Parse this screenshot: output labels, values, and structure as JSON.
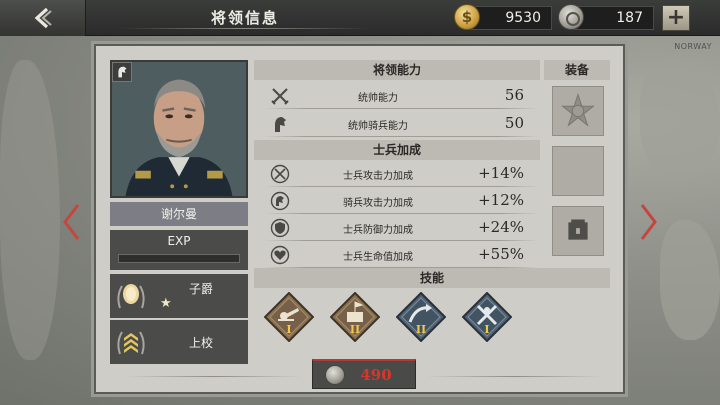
{
  "header": {
    "title": "将领信息",
    "coins": "9530",
    "medals": "187",
    "back_icon": "chevron-left-icon",
    "add_icon": "plus-icon"
  },
  "map": {
    "label": "NORWAY"
  },
  "general": {
    "name": "谢尔曼",
    "exp_label": "EXP",
    "exp_progress": 0,
    "titles": [
      {
        "name": "子爵",
        "stars": "★"
      },
      {
        "name": "上校"
      }
    ]
  },
  "abilities": {
    "heading": "将领能力",
    "rows": [
      {
        "icon": "crossed-swords-icon",
        "label": "统帅能力",
        "value": "56"
      },
      {
        "icon": "horse-head-icon",
        "label": "统帅骑兵能力",
        "value": "50"
      }
    ]
  },
  "soldier_bonus": {
    "heading": "士兵加成",
    "rows": [
      {
        "icon": "sword-attack-icon",
        "label": "士兵攻击力加成",
        "value": "+14%"
      },
      {
        "icon": "cavalry-attack-icon",
        "label": "骑兵攻击力加成",
        "value": "+12%"
      },
      {
        "icon": "shield-defense-icon",
        "label": "士兵防御力加成",
        "value": "+24%"
      },
      {
        "icon": "heart-health-icon",
        "label": "士兵生命值加成",
        "value": "+55%"
      }
    ]
  },
  "equipment": {
    "heading": "装备",
    "slots": [
      "medal-icon",
      "empty",
      "locked-chest-icon"
    ]
  },
  "skills": {
    "heading": "技能",
    "items": [
      {
        "icon": "artillery-icon",
        "level": "I",
        "style": "bronze"
      },
      {
        "icon": "fortification-icon",
        "level": "II",
        "style": "bronze"
      },
      {
        "icon": "cavalry-charge-icon",
        "level": "II",
        "style": "blue"
      },
      {
        "icon": "crossed-blades-icon",
        "level": "I",
        "style": "blue"
      }
    ]
  },
  "action": {
    "cost": "490",
    "currency_icon": "medal-icon"
  },
  "colors": {
    "cost_red": "#d9362b",
    "panel_bg": "#cfcdc7",
    "skill_bronze": "#8a6f4d",
    "skill_blue": "#4f6273",
    "level_gold": "#f1c84b"
  }
}
